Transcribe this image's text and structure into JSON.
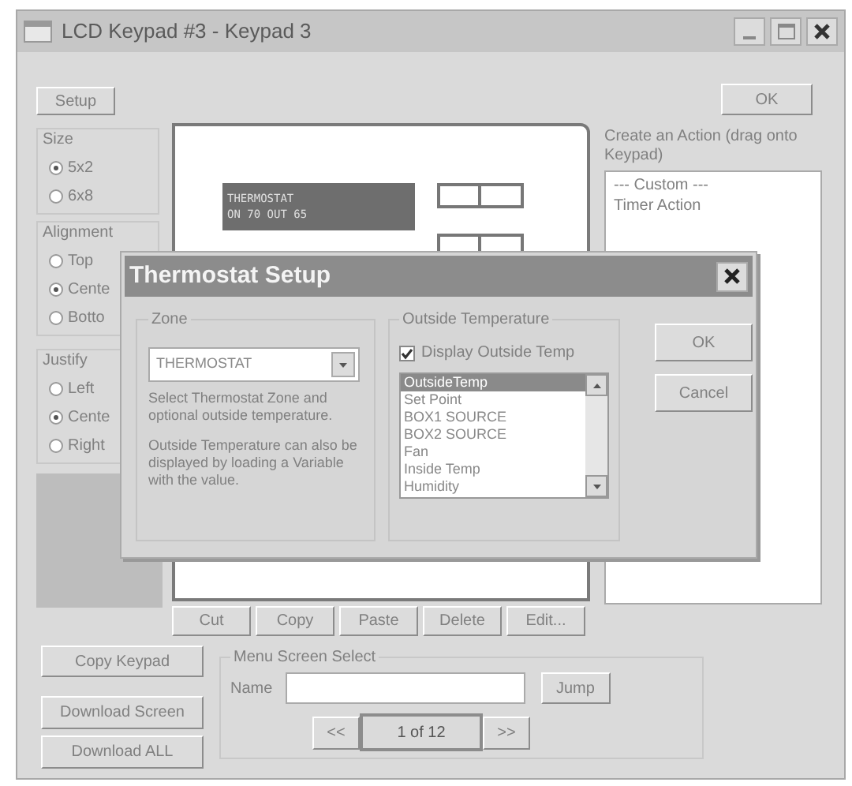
{
  "window": {
    "title": "LCD Keypad #3 - Keypad 3"
  },
  "setup_button": "Setup",
  "ok_button": "OK",
  "size": {
    "label": "Size",
    "options": [
      {
        "label": "5x2",
        "selected": true
      },
      {
        "label": "6x8",
        "selected": false
      }
    ]
  },
  "alignment": {
    "label": "Alignment",
    "options": [
      {
        "label": "Top",
        "selected": false
      },
      {
        "label": "Cente",
        "selected": true
      },
      {
        "label": "Botto",
        "selected": false
      }
    ]
  },
  "justify": {
    "label": "Justify",
    "options": [
      {
        "label": "Left",
        "selected": false
      },
      {
        "label": "Cente",
        "selected": true
      },
      {
        "label": "Right",
        "selected": false
      }
    ]
  },
  "preview": {
    "lcd_lines": [
      "THERMOSTAT",
      "ON 70 OUT 65"
    ]
  },
  "edit_buttons": [
    "Cut",
    "Copy",
    "Paste",
    "Delete",
    "Edit..."
  ],
  "actions": {
    "label": "Create an Action (drag onto Keypad)",
    "items": [
      "--- Custom ---",
      "Timer Action"
    ]
  },
  "bottom_buttons": [
    "Copy Keypad",
    "Download Screen",
    "Download ALL"
  ],
  "menu_screen_select": {
    "label": "Menu Screen Select",
    "name_label": "Name",
    "jump_button": "Jump",
    "prev_button": "<<",
    "page": "1 of 12",
    "next_button": ">>"
  },
  "dialog": {
    "title": "Thermostat Setup",
    "zone": {
      "label": "Zone",
      "value": "THERMOSTAT",
      "help": "Select Thermostat Zone and optional outside temperature.",
      "note": "Outside Temperature can also be displayed by loading a Variable with the value."
    },
    "outside": {
      "label": "Outside Temperature",
      "checkbox": {
        "label": "Display Outside Temp",
        "checked": true
      },
      "items": [
        {
          "label": "OutsideTemp",
          "selected": true
        },
        {
          "label": "Set Point",
          "selected": false
        },
        {
          "label": "BOX1 SOURCE",
          "selected": false
        },
        {
          "label": "BOX2 SOURCE",
          "selected": false
        },
        {
          "label": "Fan",
          "selected": false
        },
        {
          "label": "Inside Temp",
          "selected": false
        },
        {
          "label": "Humidity",
          "selected": false
        }
      ]
    },
    "buttons": [
      "OK",
      "Cancel"
    ]
  }
}
